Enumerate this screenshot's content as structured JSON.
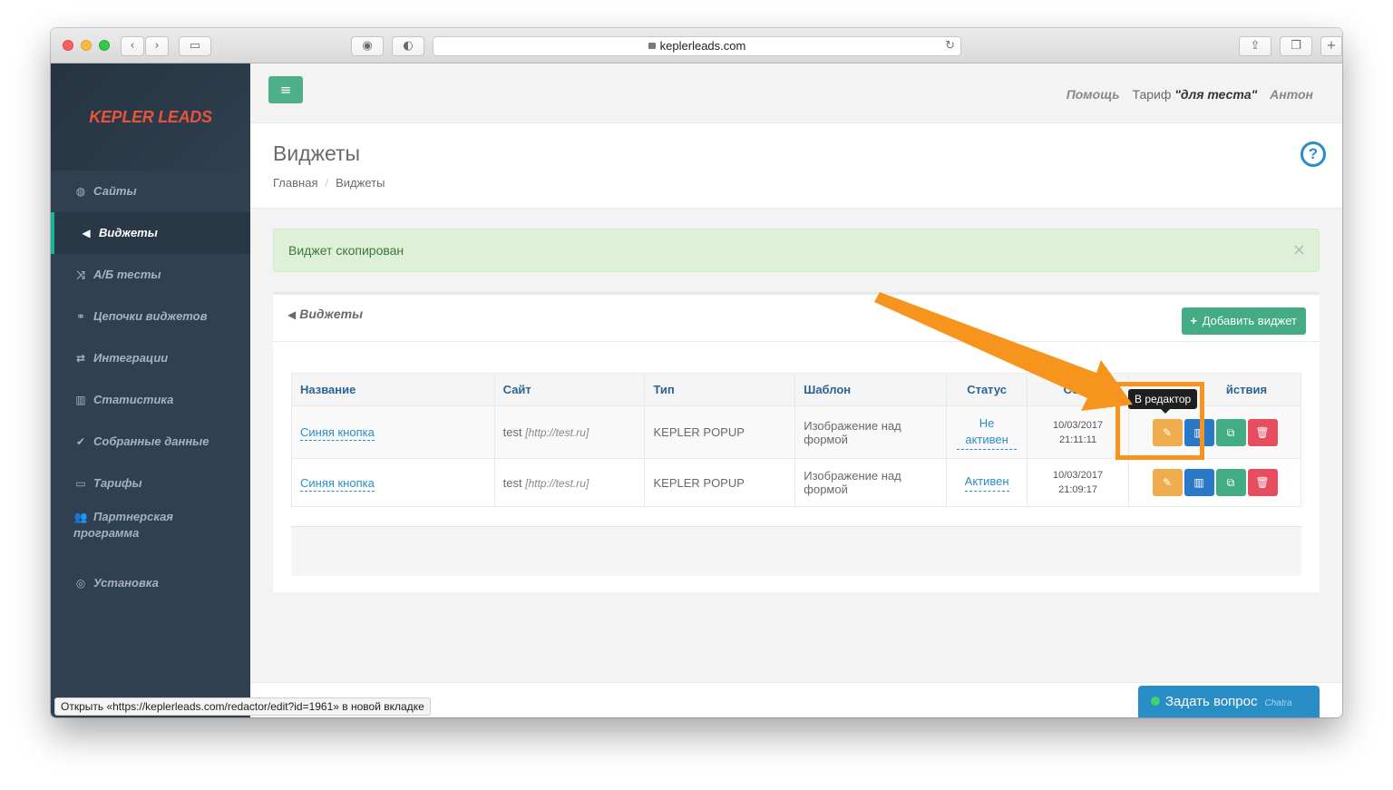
{
  "browser": {
    "url": "keplerleads.com",
    "status_text": "Открыть «https://keplerleads.com/redactor/edit?id=1961» в новой вкладке"
  },
  "app": {
    "logo": "KEPLER LEADS",
    "topnav": {
      "help": "Помощь",
      "plan_label": "Тариф",
      "plan_value": "\"для теста\"",
      "user": "Антон"
    }
  },
  "sidebar": {
    "items": [
      {
        "label": "Сайты",
        "icon": "globe-icon"
      },
      {
        "label": "Виджеты",
        "icon": "bullhorn-icon",
        "active": true
      },
      {
        "label": "А/Б тесты",
        "icon": "random-icon"
      },
      {
        "label": "Цепочки виджетов",
        "icon": "chain-icon"
      },
      {
        "label": "Интеграции",
        "icon": "exchange-icon"
      },
      {
        "label": "Статистика",
        "icon": "bar-chart-icon"
      },
      {
        "label": "Собранные данные",
        "icon": "check-icon"
      },
      {
        "label": "Тарифы",
        "icon": "credit-card-icon"
      },
      {
        "label": "Партнерская программа",
        "icon": "users-icon"
      },
      {
        "label": "Установка",
        "icon": "lifebuoy-icon"
      }
    ]
  },
  "page": {
    "title": "Виджеты",
    "breadcrumb": [
      "Главная",
      "Виджеты"
    ]
  },
  "alert": {
    "text": "Виджет скопирован"
  },
  "widgets_box": {
    "title": "Виджеты",
    "add_button": "Добавить виджет",
    "columns": [
      "Название",
      "Сайт",
      "Тип",
      "Шаблон",
      "Статус",
      "Созд",
      "йствия"
    ],
    "rows": [
      {
        "name": "Синяя кнопка",
        "site": "test",
        "site_url": "[http://test.ru]",
        "type": "KEPLER POPUP",
        "template": "Изображение над формой",
        "status": "Не активен",
        "created_date": "10/03/2017",
        "created_time": "21:11:11"
      },
      {
        "name": "Синяя кнопка",
        "site": "test",
        "site_url": "[http://test.ru]",
        "type": "KEPLER POPUP",
        "template": "Изображение над формой",
        "status": "Активен",
        "created_date": "10/03/2017",
        "created_time": "21:09:17"
      }
    ]
  },
  "tooltip": "В редактор",
  "chat": {
    "label": "Задать вопрос",
    "brand": "Chatra"
  },
  "colors": {
    "sidebar": "#2f4050",
    "accent_green": "#43ac85",
    "link_blue": "#2a8ec6",
    "logo_red": "#e8533a",
    "annotation_orange": "#f7941d"
  }
}
